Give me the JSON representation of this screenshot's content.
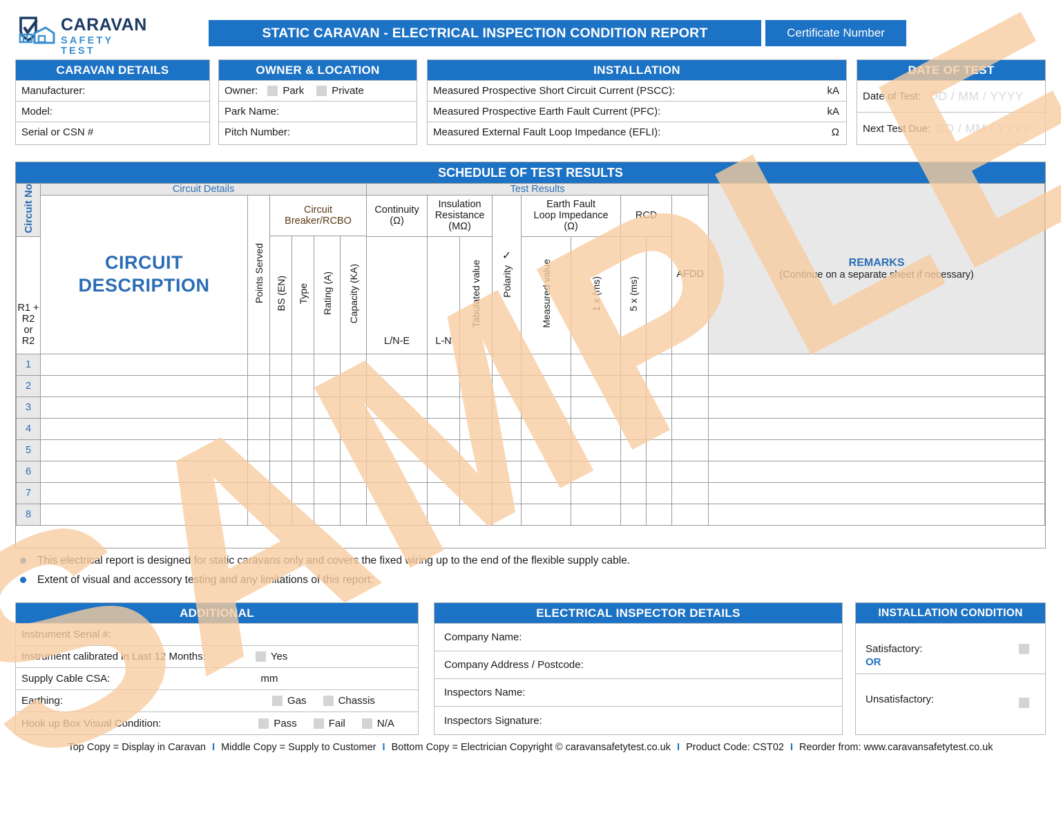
{
  "header": {
    "logo_main": "CARAVAN",
    "logo_sub": "SAFETY TEST",
    "title": "STATIC CARAVAN - ELECTRICAL INSPECTION CONDITION REPORT",
    "certificate_label": "Certificate Number"
  },
  "watermark": {
    "text": "SAMPLE",
    "color": "#f9cda0"
  },
  "caravan_details": {
    "heading": "CARAVAN DETAILS",
    "rows": [
      {
        "label": "Manufacturer:"
      },
      {
        "label": "Model:"
      },
      {
        "label": "Serial or CSN #"
      }
    ]
  },
  "owner_location": {
    "heading": "OWNER & LOCATION",
    "owner_label": "Owner:",
    "owner_options": [
      "Park",
      "Private"
    ],
    "rows": [
      {
        "label": "Park Name:"
      },
      {
        "label": "Pitch Number:"
      }
    ]
  },
  "installation": {
    "heading": "INSTALLATION",
    "rows": [
      {
        "label": "Measured Prospective Short Circuit Current (PSCC):",
        "unit": "kA"
      },
      {
        "label": "Measured Prospective Earth Fault Current (PFC):",
        "unit": "kA"
      },
      {
        "label": "Measured External Fault Loop Impedance (EFLI):",
        "unit": "Ω"
      }
    ]
  },
  "date_of_test": {
    "heading": "DATE OF TEST",
    "rows": [
      {
        "label": "Date of Test:",
        "placeholder": "DD / MM / YYYY"
      },
      {
        "label": "Next Test Due:",
        "placeholder": "DD / MM / YYYY"
      }
    ]
  },
  "schedule": {
    "heading": "SCHEDULE OF TEST RESULTS",
    "band_circuit_details": "Circuit Details",
    "band_test_results": "Test Results",
    "circuit_no_label": "Circuit No",
    "circuit_description_line1": "CIRCUIT",
    "circuit_description_line2": "DESCRIPTION",
    "points_served": "Points Served",
    "circuit_breaker_group": "Circuit Breaker/RCBO",
    "breaker_cols": [
      "BS (EN)",
      "Type",
      "Rating (A)",
      "Capacity (KA)"
    ],
    "continuity_group": "Continuity\n(Ω)",
    "continuity_title": "Continuity",
    "continuity_unit": "(Ω)",
    "continuity_sub": "R1 + R2 or R2",
    "insulation_title": "Insulation",
    "insulation_title2": "Resistance",
    "insulation_unit": "(MΩ)",
    "insulation_cols": [
      "L/N-E",
      "L-N"
    ],
    "polarity": "Polarity",
    "polarity_tick": "✓",
    "efli_title": "Earth Fault",
    "efli_title2": "Loop Impedance",
    "efli_unit": "(Ω)",
    "efli_cols": [
      "Tabulated value",
      "Measured value"
    ],
    "rcd_group": "RCD",
    "rcd_cols": [
      "1 x (ms)",
      "5 x (ms)"
    ],
    "afdd": "AFDD",
    "remarks_title": "REMARKS",
    "remarks_sub": "(Continue on a separate sheet if necessary)",
    "circuit_numbers": [
      "1",
      "2",
      "3",
      "4",
      "5",
      "6",
      "7",
      "8"
    ]
  },
  "notes": [
    "This electrical report is designed for static caravans only and covers the fixed wiring up to the end of the flexible supply cable.",
    "Extent of visual and accessory testing and any limitations of this report:"
  ],
  "additional": {
    "heading": "ADDITIONAL",
    "rows": [
      {
        "label": "Instrument Serial #:",
        "options": []
      },
      {
        "label": "Instrument calibrated in Last 12 Months:",
        "options": [
          "Yes"
        ]
      },
      {
        "label": "Supply Cable CSA:",
        "unit": "mm",
        "options": []
      },
      {
        "label": "Earthing:",
        "options": [
          "Gas",
          "Chassis"
        ]
      },
      {
        "label": "Hook up Box Visual Condition:",
        "options": [
          "Pass",
          "Fail",
          "N/A"
        ]
      }
    ]
  },
  "inspector": {
    "heading": "ELECTRICAL INSPECTOR DETAILS",
    "rows": [
      {
        "label": "Company Name:"
      },
      {
        "label": "Company Address / Postcode:"
      },
      {
        "label": "Inspectors Name:"
      },
      {
        "label": "Inspectors Signature:"
      }
    ]
  },
  "installation_condition": {
    "heading": "INSTALLATION CONDITION",
    "satisfactory": "Satisfactory:",
    "or": "OR",
    "unsatisfactory": "Unsatisfactory:"
  },
  "footer": {
    "items": [
      "Top Copy = Display in Caravan",
      "Middle Copy = Supply to Customer",
      "Bottom Copy = Electrician Copyright © caravansafetytest.co.uk",
      "Product Code: CST02",
      "Reorder from: www.caravansafetytest.co.uk"
    ],
    "separator": "I"
  },
  "colors": {
    "brand_blue": "#1c72c4",
    "band_gray": "#e8e8e8",
    "checkbox": "#d4d4d4"
  }
}
